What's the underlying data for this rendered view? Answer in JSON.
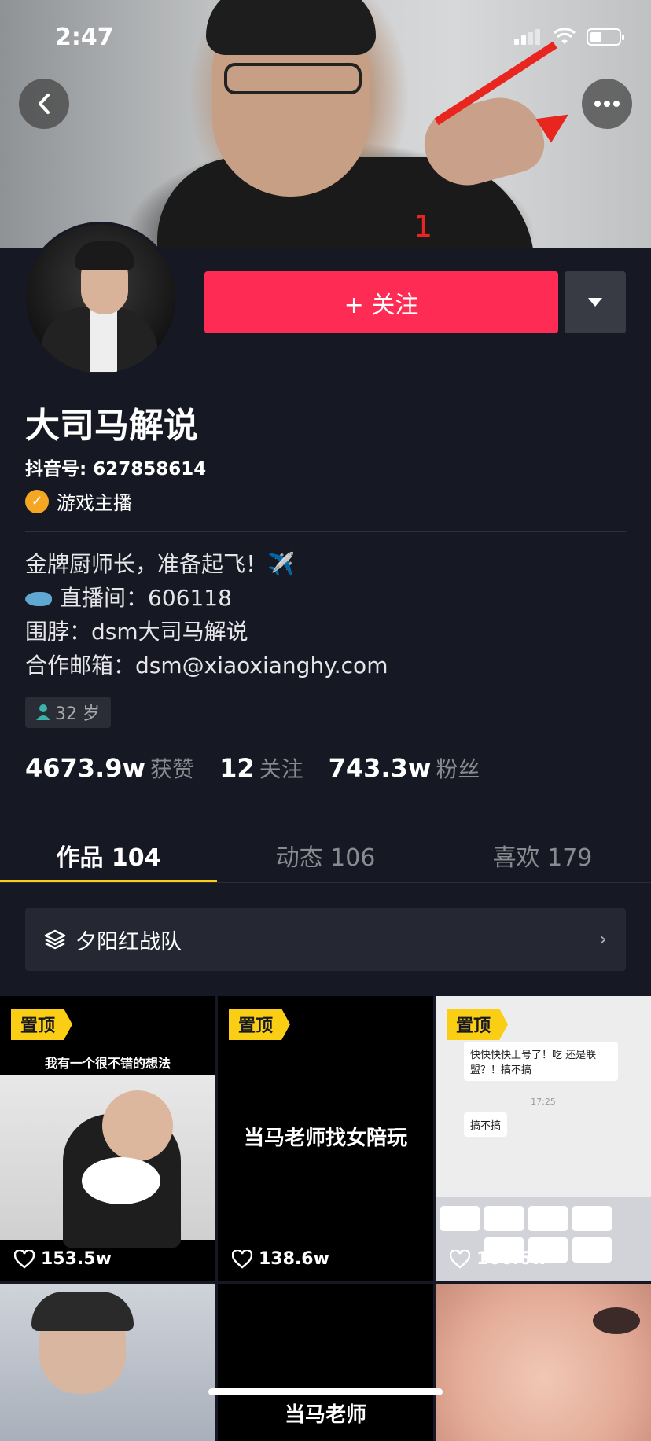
{
  "status_bar": {
    "time": "2:47"
  },
  "annotation": {
    "number": "1"
  },
  "profile": {
    "follow_label": "+ 关注",
    "name": "大司马解说",
    "douyin_id": "抖音号: 627858614",
    "verified_label": "游戏主播",
    "bio": [
      "金牌厨师长，准备起飞！✈️",
      "直播间：606118",
      "围脖：dsm大司马解说",
      "合作邮箱：dsm@xiaoxianghy.com"
    ],
    "age": "32 岁"
  },
  "stats": {
    "likes_value": "4673.9w",
    "likes_label": "获赞",
    "following_value": "12",
    "following_label": "关注",
    "followers_value": "743.3w",
    "followers_label": "粉丝"
  },
  "tabs": [
    {
      "label": "作品 104",
      "active": true
    },
    {
      "label": "动态 106",
      "active": false
    },
    {
      "label": "喜欢 179",
      "active": false
    }
  ],
  "collection": {
    "label": "夕阳红战队"
  },
  "videos": [
    {
      "pinned": "置顶",
      "caption": "我有一个很不错的想法",
      "likes": "153.5w"
    },
    {
      "pinned": "置顶",
      "caption": "当马老师找女陪玩",
      "likes": "138.6w"
    },
    {
      "pinned": "置顶",
      "chat_1": "快快快快上号了！吃 还是联盟？！搞不搞",
      "chat_time": "17:25",
      "chat_2": "搞不搞",
      "likes": "166.6w"
    }
  ],
  "videos_row2": [
    {
      "caption": "当马老师"
    }
  ],
  "colors": {
    "accent": "#fe2c55",
    "highlight": "#face15",
    "background": "#161823"
  }
}
